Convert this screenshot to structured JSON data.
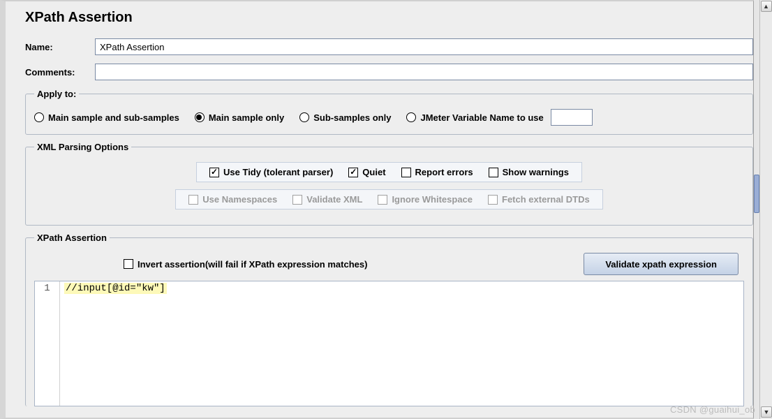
{
  "header": {
    "title": "XPath Assertion"
  },
  "form": {
    "name_label": "Name:",
    "name_value": "XPath Assertion",
    "comments_label": "Comments:",
    "comments_value": ""
  },
  "apply": {
    "legend": "Apply to:",
    "options": {
      "main_and_sub": "Main sample and sub-samples",
      "main_only": "Main sample only",
      "sub_only": "Sub-samples only",
      "jmeter_var": "JMeter Variable Name to use"
    },
    "selected": "main_only",
    "jmeter_var_value": ""
  },
  "xml_opts": {
    "legend": "XML Parsing Options",
    "row1": {
      "use_tidy": {
        "label": "Use Tidy (tolerant parser)",
        "checked": true
      },
      "quiet": {
        "label": "Quiet",
        "checked": true
      },
      "report_errors": {
        "label": "Report errors",
        "checked": false
      },
      "show_warnings": {
        "label": "Show warnings",
        "checked": false
      }
    },
    "row2": {
      "use_namespaces": {
        "label": "Use Namespaces",
        "checked": false,
        "disabled": true
      },
      "validate_xml": {
        "label": "Validate XML",
        "checked": false,
        "disabled": true
      },
      "ignore_whitespace": {
        "label": "Ignore Whitespace",
        "checked": false,
        "disabled": true
      },
      "fetch_dtds": {
        "label": "Fetch external DTDs",
        "checked": false,
        "disabled": true
      }
    }
  },
  "xpath": {
    "legend": "XPath Assertion",
    "invert_label": "Invert assertion(will fail if XPath expression matches)",
    "invert_checked": false,
    "validate_button": "Validate xpath expression",
    "line_number": "1",
    "expression": "//input[@id=\"kw\"]"
  },
  "watermark": "CSDN @guaihui_ob"
}
